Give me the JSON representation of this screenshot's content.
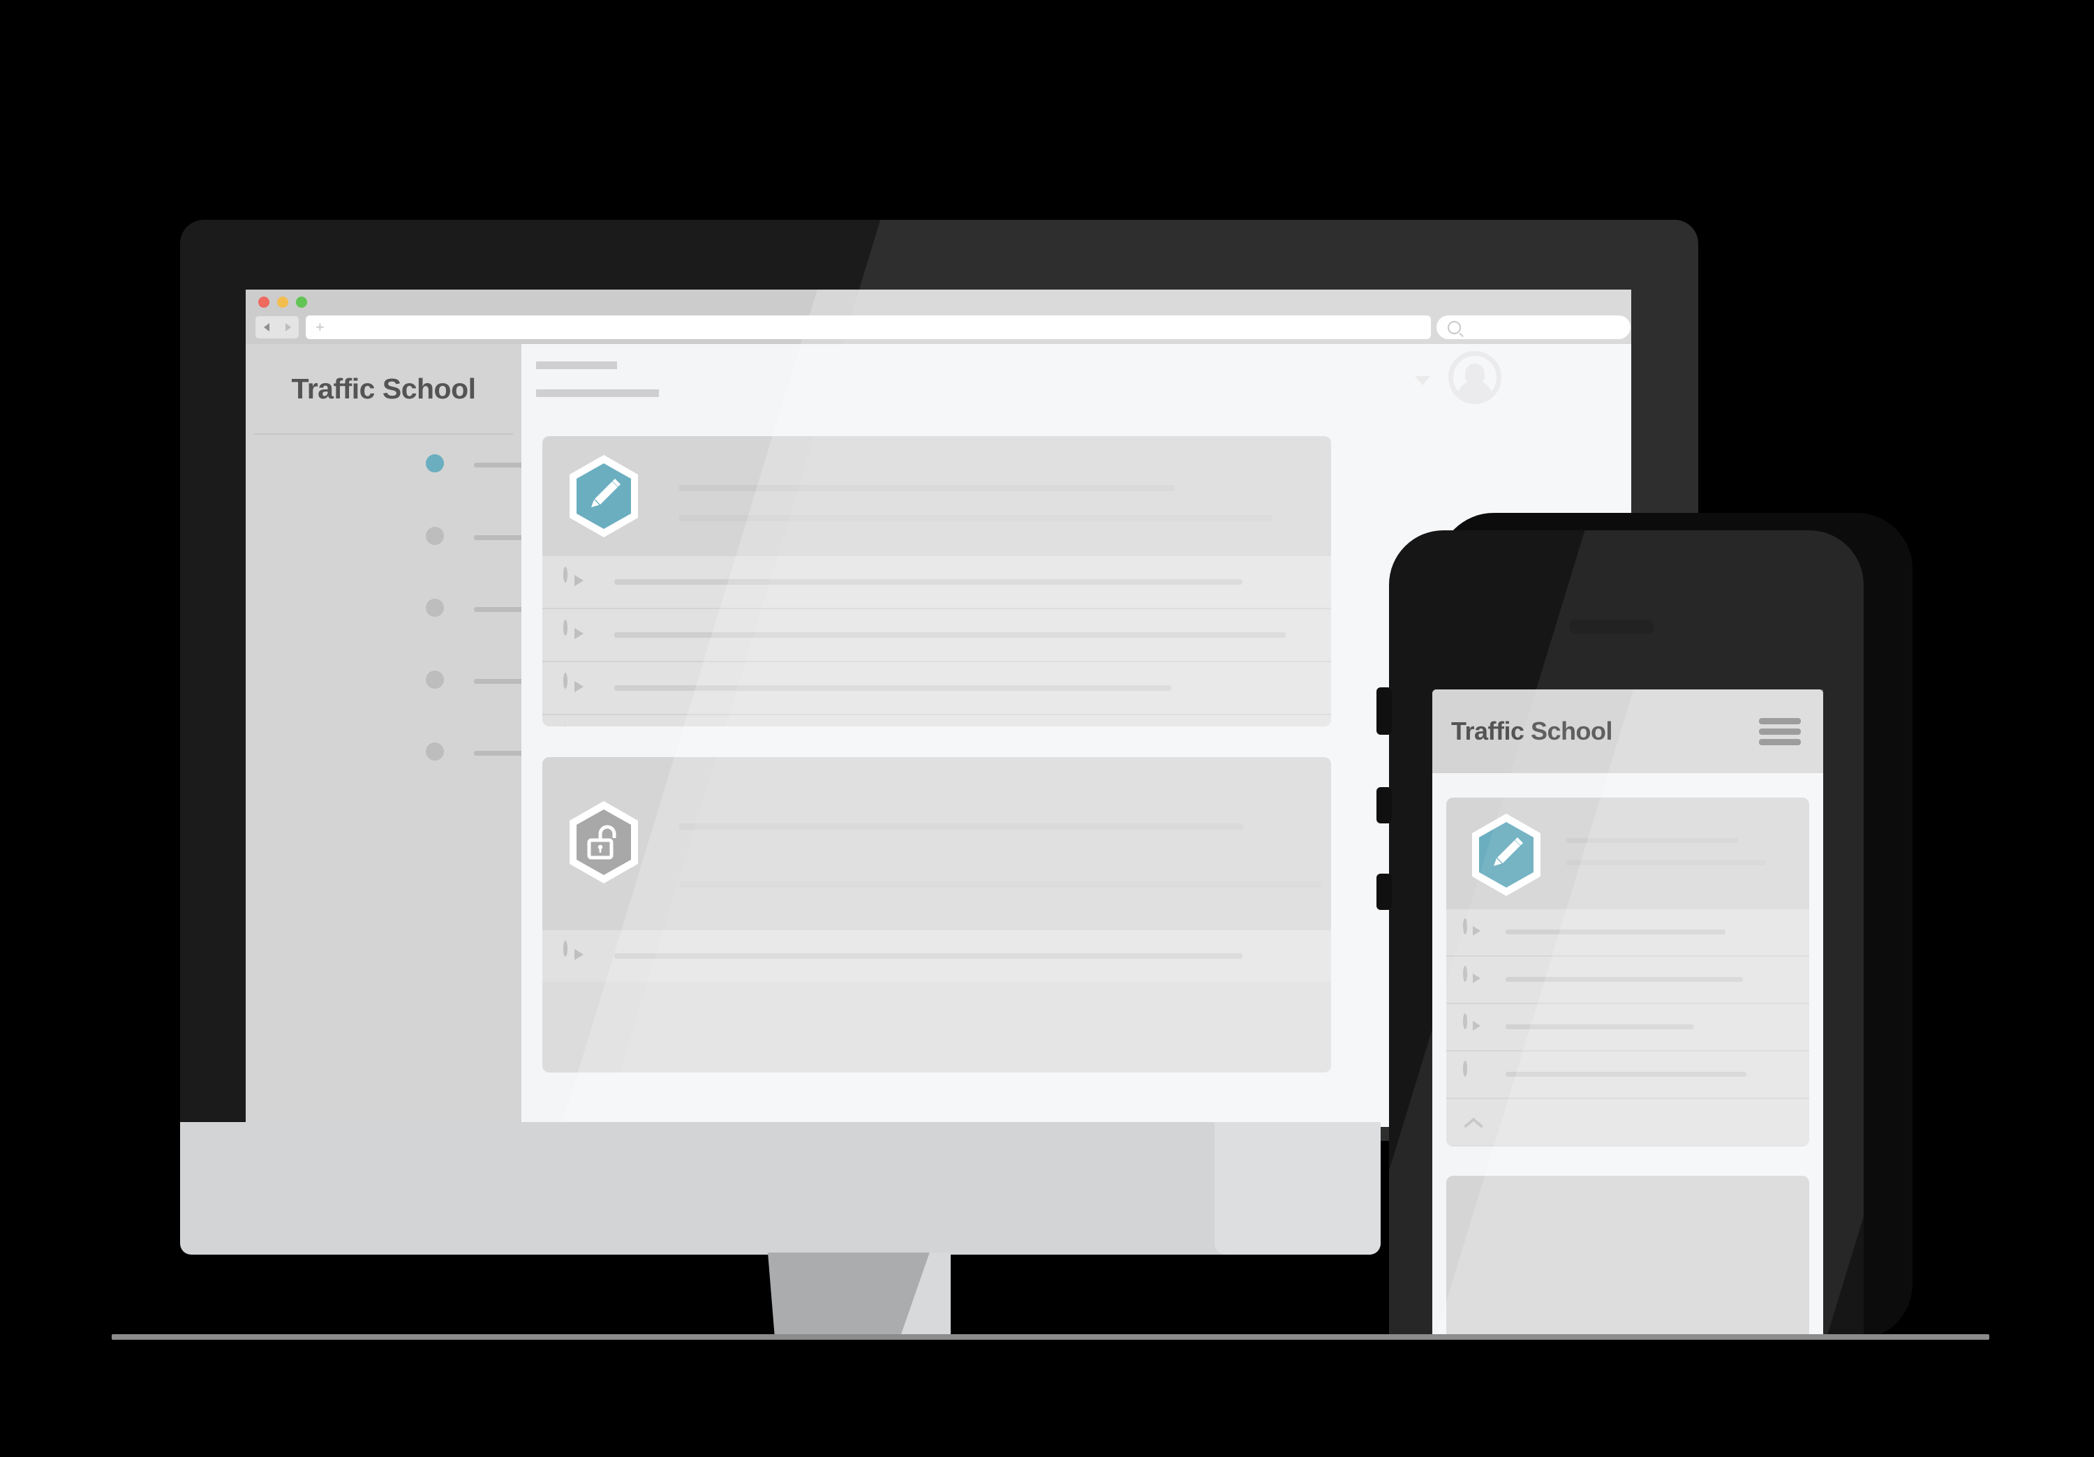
{
  "browser": {
    "window_controls": [
      {
        "name": "close",
        "color": "#ee6a5f"
      },
      {
        "name": "minimize",
        "color": "#f4bd4f"
      },
      {
        "name": "maximize",
        "color": "#61c454"
      }
    ],
    "back_icon": "back-arrow-icon",
    "forward_icon": "forward-arrow-icon",
    "url_value": "",
    "url_placeholder": "",
    "new_tab_glyph": "+",
    "search_placeholder": "",
    "search_icon": "search-icon"
  },
  "desktop_app": {
    "brand": "Traffic School",
    "accent_color": "#6BAEC0",
    "sidebar": {
      "items": [
        {
          "label": "",
          "active": true,
          "dot_color": "#6BAEC0"
        },
        {
          "label": "",
          "active": false,
          "dot_color": "#bdbdbd"
        },
        {
          "label": "",
          "active": false,
          "dot_color": "#bdbdbd"
        },
        {
          "label": "",
          "active": false,
          "dot_color": "#bdbdbd"
        },
        {
          "label": "",
          "active": false,
          "dot_color": "#bdbdbd"
        }
      ]
    },
    "header": {
      "title_placeholder": "",
      "subtitle_placeholder": "",
      "account_caret_icon": "chevron-down-icon",
      "avatar_icon": "user-avatar-icon"
    },
    "cards": [
      {
        "badge_icon": "pencil-hexagon-icon",
        "badge_color": "#6BAEC0",
        "title_placeholder": "",
        "subtitle_placeholder": "",
        "rows": [
          {
            "icon": "play-circle-icon",
            "label": ""
          },
          {
            "icon": "play-circle-icon",
            "label": ""
          },
          {
            "icon": "play-circle-icon",
            "label": ""
          },
          {
            "icon": "more-dots-circle-icon",
            "label": ""
          }
        ],
        "collapse_icon": "chevron-up-icon"
      },
      {
        "badge_icon": "unlock-hexagon-icon",
        "badge_color": "#a8a8a8",
        "title_placeholder": "",
        "subtitle_placeholder": "",
        "rows": [
          {
            "icon": "play-circle-icon",
            "label": ""
          }
        ],
        "collapse_icon": ""
      }
    ]
  },
  "mobile_app": {
    "brand": "Traffic School",
    "menu_icon": "hamburger-menu-icon",
    "cards": [
      {
        "badge_icon": "pencil-hexagon-icon",
        "badge_color": "#6BAEC0",
        "title_placeholder": "",
        "subtitle_placeholder": "",
        "rows": [
          {
            "icon": "play-circle-icon",
            "label": ""
          },
          {
            "icon": "play-circle-icon",
            "label": ""
          },
          {
            "icon": "play-circle-icon",
            "label": ""
          },
          {
            "icon": "more-dots-circle-icon",
            "label": ""
          }
        ],
        "collapse_icon": "chevron-up-icon"
      },
      {
        "badge_icon": "",
        "badge_color": "#d2d2d2",
        "title_placeholder": "",
        "subtitle_placeholder": "",
        "rows": [],
        "collapse_icon": ""
      }
    ]
  },
  "devices": {
    "monitor": "desktop-monitor",
    "phone": "smartphone"
  }
}
